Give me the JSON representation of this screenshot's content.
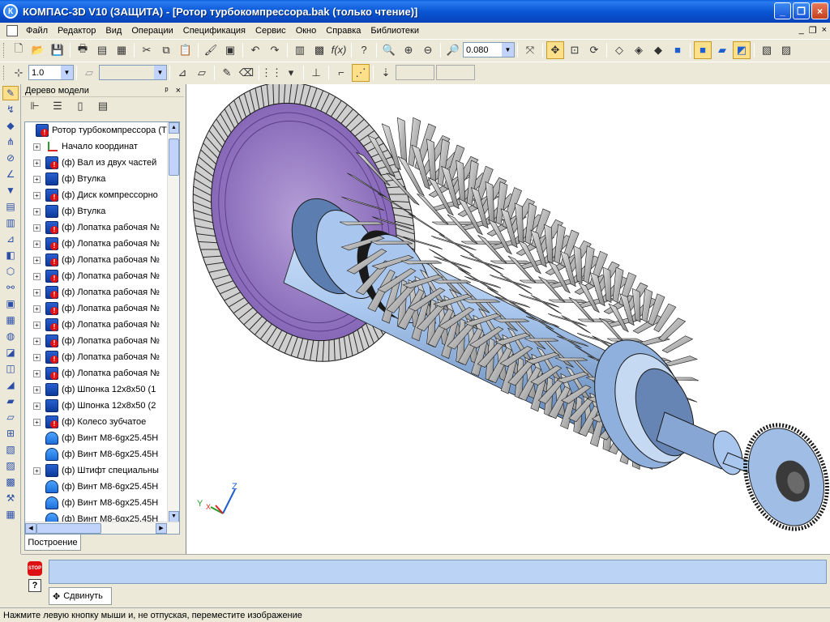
{
  "window": {
    "app_logo": "К",
    "title": "КОМПАС-3D V10 (ЗАЩИТА) - [Ротор турбокомпрессора.bak (только чтение)]",
    "minimize": "_",
    "maximize": "❐",
    "close": "×"
  },
  "menu": {
    "items": [
      "Файл",
      "Редактор",
      "Вид",
      "Операции",
      "Спецификация",
      "Сервис",
      "Окно",
      "Справка",
      "Библиотеки"
    ],
    "mdi": [
      "_",
      "❐",
      "×"
    ]
  },
  "toolbar1": {
    "zoom_value": "0.080"
  },
  "toolbar2": {
    "step_value": "1.0"
  },
  "tree_panel": {
    "title": "Дерево модели",
    "pin": "ᵖ",
    "close": "×",
    "tab_label": "Построение",
    "items": [
      {
        "label": "Ротор турбокомпрессора (Т",
        "icon": "assembly-icon",
        "expand": "",
        "indent": 0
      },
      {
        "label": "Начало координат",
        "icon": "axis-icon",
        "expand": "+",
        "indent": 1
      },
      {
        "label": "(ф) Вал из двух частей",
        "icon": "part-warning-icon",
        "expand": "+",
        "indent": 1
      },
      {
        "label": "(ф) Втулка",
        "icon": "part-icon",
        "expand": "+",
        "indent": 1
      },
      {
        "label": "(ф) Диск компрессорно",
        "icon": "part-warning-icon",
        "expand": "+",
        "indent": 1
      },
      {
        "label": "(ф) Втулка",
        "icon": "part-icon",
        "expand": "+",
        "indent": 1
      },
      {
        "label": "(ф) Лопатка рабочая №",
        "icon": "part-warning-icon",
        "expand": "+",
        "indent": 1
      },
      {
        "label": "(ф) Лопатка рабочая №",
        "icon": "part-warning-icon",
        "expand": "+",
        "indent": 1
      },
      {
        "label": "(ф) Лопатка рабочая №",
        "icon": "part-warning-icon",
        "expand": "+",
        "indent": 1
      },
      {
        "label": "(ф) Лопатка рабочая №",
        "icon": "part-warning-icon",
        "expand": "+",
        "indent": 1
      },
      {
        "label": "(ф) Лопатка рабочая №",
        "icon": "part-warning-icon",
        "expand": "+",
        "indent": 1
      },
      {
        "label": "(ф) Лопатка рабочая №",
        "icon": "part-warning-icon",
        "expand": "+",
        "indent": 1
      },
      {
        "label": "(ф) Лопатка рабочая №",
        "icon": "part-warning-icon",
        "expand": "+",
        "indent": 1
      },
      {
        "label": "(ф) Лопатка рабочая №",
        "icon": "part-warning-icon",
        "expand": "+",
        "indent": 1
      },
      {
        "label": "(ф) Лопатка рабочая №",
        "icon": "part-warning-icon",
        "expand": "+",
        "indent": 1
      },
      {
        "label": "(ф) Лопатка рабочая №",
        "icon": "part-warning-icon",
        "expand": "+",
        "indent": 1
      },
      {
        "label": "(ф) Шпонка 12х8х50 (1",
        "icon": "part-icon",
        "expand": "+",
        "indent": 1
      },
      {
        "label": "(ф) Шпонка 12х8х50 (2",
        "icon": "part-icon",
        "expand": "+",
        "indent": 1
      },
      {
        "label": "(ф) Колесо зубчатое",
        "icon": "part-warning-icon",
        "expand": "+",
        "indent": 1
      },
      {
        "label": "(ф) Винт М8-6gх25.45Н",
        "icon": "bolt-icon",
        "expand": "",
        "indent": 1
      },
      {
        "label": "(ф) Винт М8-6gх25.45Н",
        "icon": "bolt-icon",
        "expand": "",
        "indent": 1
      },
      {
        "label": "(ф) Штифт специальны",
        "icon": "part-icon",
        "expand": "+",
        "indent": 1
      },
      {
        "label": "(ф) Винт М8-6gх25.45Н",
        "icon": "bolt-icon",
        "expand": "",
        "indent": 1
      },
      {
        "label": "(ф) Винт М8-6gх25.45Н",
        "icon": "bolt-icon",
        "expand": "",
        "indent": 1
      },
      {
        "label": "(ф) Винт М8-6gх25.45Н",
        "icon": "bolt-icon",
        "expand": "",
        "indent": 1
      }
    ]
  },
  "viewport": {
    "axis_labels": {
      "x": "X",
      "y": "Y",
      "z": "Z"
    },
    "colors": {
      "rotor": "#A9C7EE",
      "disk": "#9C7CC6",
      "blades": "#B4B4B4",
      "edges": "#1a1a1a"
    }
  },
  "properties": {
    "stop_label": "STOP",
    "help_label": "?",
    "move_tab": "Сдвинуть"
  },
  "status": {
    "text": "Нажмите левую кнопку мыши и, не отпуская, переместите изображение"
  }
}
